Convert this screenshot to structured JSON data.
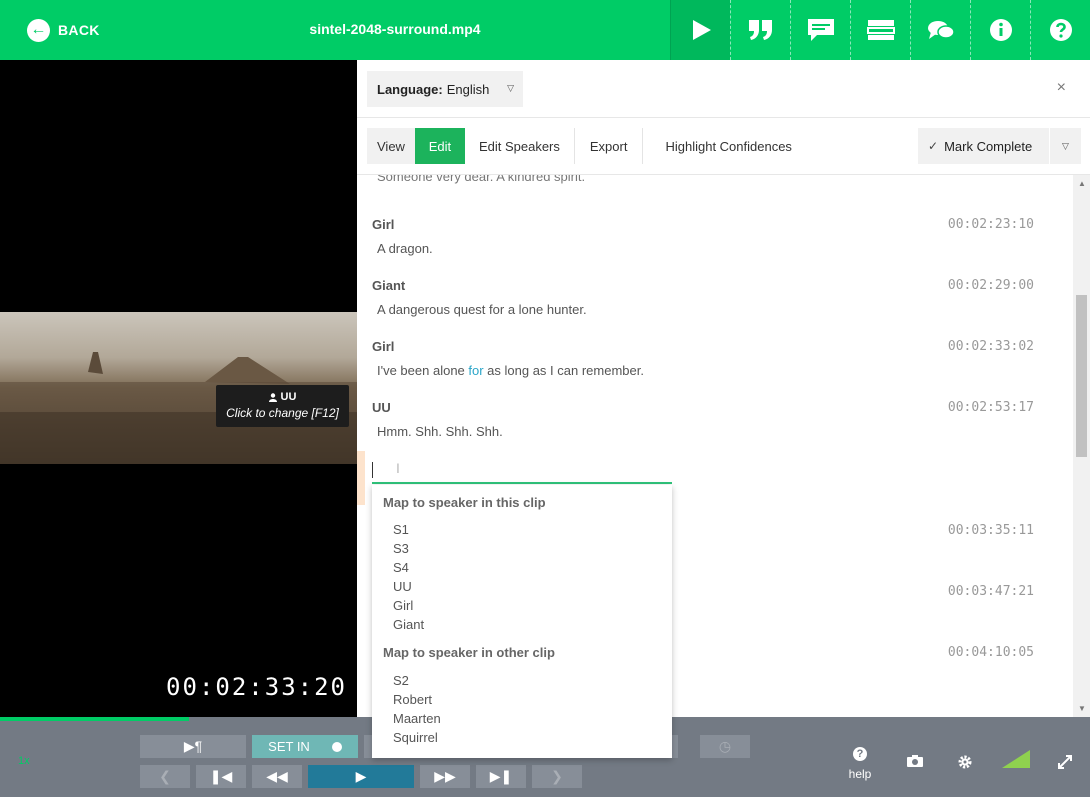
{
  "topbar": {
    "back_label": "BACK",
    "filename": "sintel-2048-surround.mp4",
    "buttons": [
      "play-icon",
      "quote-icon",
      "subtitle-icon",
      "layout-icon",
      "comments-icon",
      "info-icon",
      "help-icon"
    ],
    "colors": {
      "brand": "#00cc66"
    }
  },
  "video": {
    "speaker": "UU",
    "speaker_hint": "Click to change [F12]",
    "timecode": "00:02:33:20"
  },
  "panel": {
    "language_label": "Language:",
    "language_value": "English",
    "tabs": {
      "view": "View",
      "edit": "Edit",
      "edit_speakers": "Edit Speakers",
      "export": "Export",
      "highlight": "Highlight Confidences"
    },
    "mark_complete": "Mark Complete"
  },
  "transcript": {
    "partial_text": "Someone very dear. A kindred spirit.",
    "entries": [
      {
        "speaker": "Girl",
        "time": "00:02:23:10",
        "text": "A dragon."
      },
      {
        "speaker": "Giant",
        "time": "00:02:29:00",
        "text": "A dangerous quest for a lone hunter."
      },
      {
        "speaker": "Girl",
        "time": "00:02:33:02",
        "text_before": "I've been alone ",
        "text_highlight": "for",
        "text_after": " as long as I can remember."
      },
      {
        "speaker": "UU",
        "time": "00:02:53:17",
        "text": "Hmm. Shh. Shh. Shh."
      }
    ],
    "later_times": [
      "00:03:35:11",
      "00:03:47:21",
      "00:04:10:05"
    ]
  },
  "speaker_dropdown": {
    "this_clip_heading": "Map to speaker in this clip",
    "this_clip": [
      "S1",
      "S3",
      "S4",
      "UU",
      "Girl",
      "Giant"
    ],
    "other_clip_heading": "Map to speaker in other clip",
    "other_clip": [
      "S2",
      "Robert",
      "Maarten",
      "Squirrel"
    ]
  },
  "controls": {
    "set_in": "SET IN",
    "help": "help",
    "zoom_label": "1x"
  }
}
